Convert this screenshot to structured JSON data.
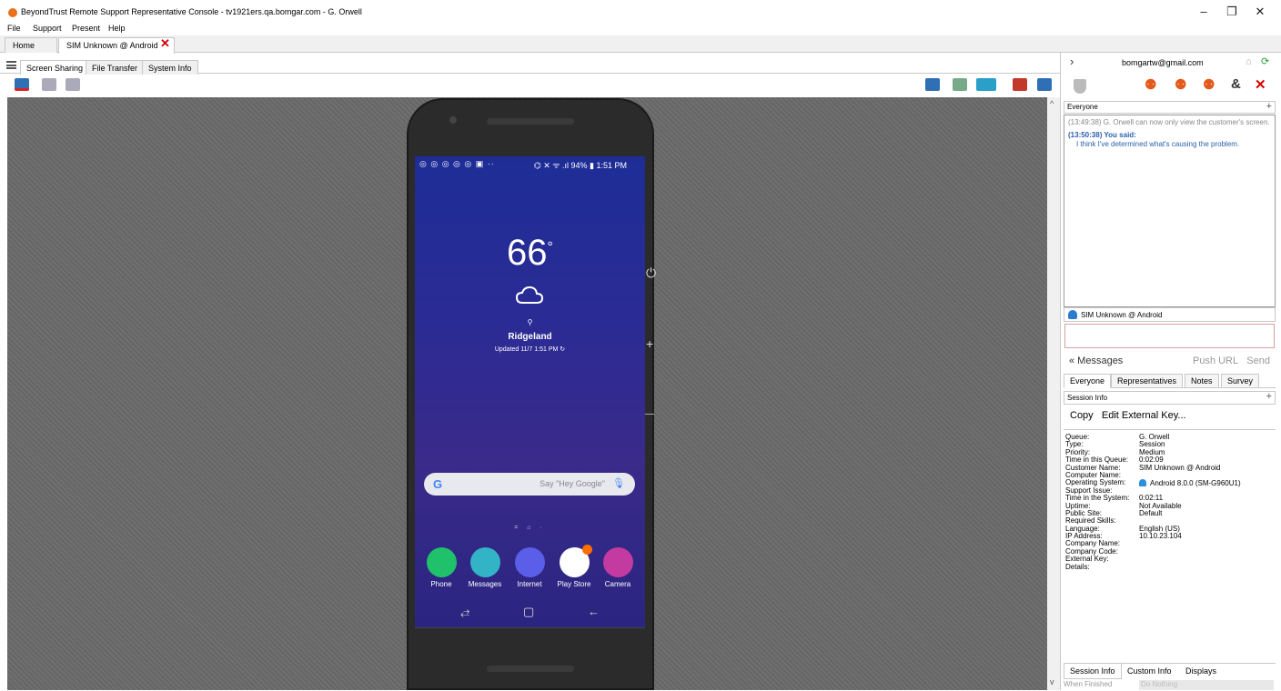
{
  "window": {
    "title": "BeyondTrust Remote Support Representative Console - tv1921ers.qa.bomgar.com - G. Orwell",
    "controls": {
      "minimize": "–",
      "restore": "❐",
      "close": "✕"
    }
  },
  "menu": [
    "File",
    "Support",
    "Present",
    "Help"
  ],
  "session_tabs": [
    "Home",
    "SIM Unknown @ Android"
  ],
  "sub_tabs": [
    "Screen Sharing",
    "File Transfer",
    "System Info"
  ],
  "phone": {
    "status_left": "◎ ◎ ◎ ◎ ◎ ▣  ··",
    "status_right": "⌬ ✕ ᯤ .ıl 94% ▮ 1:51 PM",
    "temperature": "66",
    "degree": "°",
    "location_pin": "⚲",
    "city": "Ridgeland",
    "updated": "Updated 11/7 1:51 PM ↻",
    "search_g": "G",
    "search_placeholder": "Say \"Hey Google\"",
    "page_dots": "= ⌂ ·",
    "apps": [
      {
        "label": "Phone",
        "color": "#1fc26b",
        "glyph": "✆"
      },
      {
        "label": "Messages",
        "color": "#33b3c6",
        "glyph": "▢"
      },
      {
        "label": "Internet",
        "color": "#5a5ee8",
        "glyph": "◐"
      },
      {
        "label": "Play Store",
        "color": "#ffffff",
        "glyph": "▶"
      },
      {
        "label": "Camera",
        "color": "#c33aa0",
        "glyph": "◎"
      }
    ],
    "nav": {
      "recent": "⥄",
      "home": "▢",
      "back": "←"
    }
  },
  "side_icons": {
    "power": "⏻",
    "vol_up": "+",
    "vol_down": "—"
  },
  "scroll": {
    "up": "^",
    "down": "v"
  },
  "right_panel": {
    "email": "bomgartw@gmail.com",
    "chat_header": "Everyone",
    "plus": "+",
    "messages": {
      "system": "(13:49:38) G. Orwell can now only view the customer's screen.",
      "you_said": "(13:50:38) You said:",
      "you_msg": "I think I've determined what's causing the problem."
    },
    "recipient": "SIM Unknown @ Android",
    "messages_link": "« Messages",
    "push_url": "Push URL",
    "send": "Send",
    "chat_tabs": [
      "Everyone",
      "Representatives",
      "Notes",
      "Survey"
    ],
    "session_info_header": "Session Info",
    "copy": "Copy",
    "edit_key": "Edit External Key...",
    "session_info": [
      {
        "label": "Queue:",
        "value": "G. Orwell"
      },
      {
        "label": "Type:",
        "value": "Session"
      },
      {
        "label": "Priority:",
        "value": "Medium"
      },
      {
        "label": "Time in this Queue:",
        "value": "0:02:09"
      },
      {
        "label": "Customer Name:",
        "value": "SIM Unknown @ Android"
      },
      {
        "label": "Computer Name:",
        "value": ""
      },
      {
        "label": "Operating System:",
        "value": "Android 8.0.0 (SM-G960U1)"
      },
      {
        "label": "Support Issue:",
        "value": ""
      },
      {
        "label": "Time in the System:",
        "value": "0:02:11"
      },
      {
        "label": "Uptime:",
        "value": "Not Available"
      },
      {
        "label": "Public Site:",
        "value": "Default"
      },
      {
        "label": "Required Skills:",
        "value": ""
      },
      {
        "label": "Language:",
        "value": "English (US)"
      },
      {
        "label": "IP Address:",
        "value": "10.10.23.104"
      },
      {
        "label": "Company Name:",
        "value": ""
      },
      {
        "label": "Company Code:",
        "value": ""
      },
      {
        "label": "External Key:",
        "value": ""
      },
      {
        "label": "Details:",
        "value": ""
      }
    ],
    "bottom_tabs": [
      "Session Info",
      "Custom Info",
      "Displays"
    ],
    "when_finished_label": "When Finished",
    "when_finished_value": "Do Nothing"
  }
}
